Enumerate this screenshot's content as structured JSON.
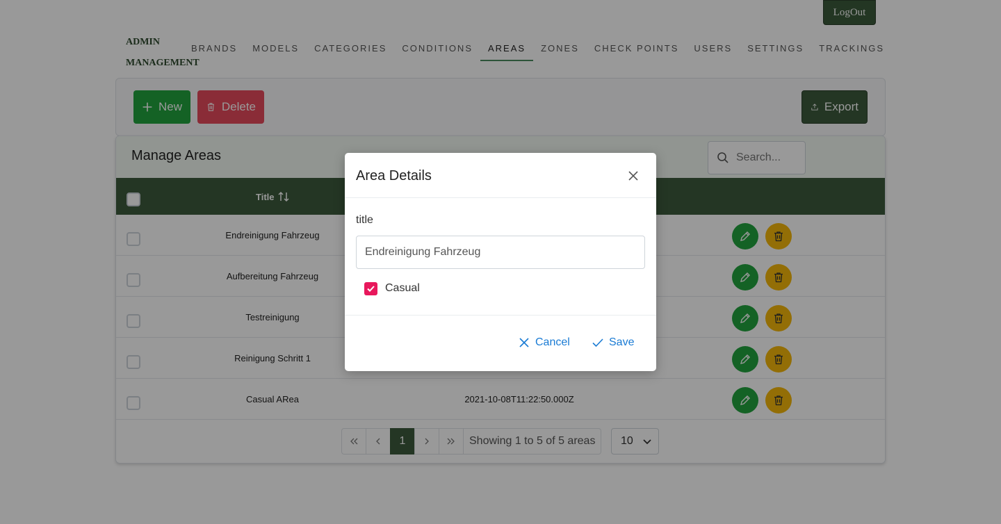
{
  "header": {
    "logout_label": "LogOut",
    "brand_line1": "ADMIN",
    "brand_line2": "MANAGEMENT",
    "nav": [
      {
        "label": "BRANDS",
        "active": false
      },
      {
        "label": "MODELS",
        "active": false
      },
      {
        "label": "CATEGORIES",
        "active": false
      },
      {
        "label": "CONDITIONS",
        "active": false
      },
      {
        "label": "AREAS",
        "active": true
      },
      {
        "label": "ZONES",
        "active": false
      },
      {
        "label": "CHECK POINTS",
        "active": false
      },
      {
        "label": "USERS",
        "active": false
      },
      {
        "label": "SETTINGS",
        "active": false
      },
      {
        "label": "TRACKINGS",
        "active": false
      }
    ]
  },
  "toolbar": {
    "new_label": "New",
    "delete_label": "Delete",
    "export_label": "Export"
  },
  "table": {
    "title": "Manage Areas",
    "search_placeholder": "Search...",
    "columns": {
      "title": "Title"
    },
    "rows": [
      {
        "title": "Endreinigung Fahrzeug",
        "date": ""
      },
      {
        "title": "Aufbereitung Fahrzeug",
        "date": ""
      },
      {
        "title": "Testreinigung",
        "date": ""
      },
      {
        "title": "Reinigung Schritt 1",
        "date": ""
      },
      {
        "title": "Casual ARea",
        "date": "2021-10-08T11:22:50.000Z"
      }
    ]
  },
  "pagination": {
    "current_page": "1",
    "info": "Showing 1 to 5 of 5 areas",
    "per_page": "10"
  },
  "modal": {
    "title": "Area Details",
    "field_label": "title",
    "field_value": "Endreinigung Fahrzeug",
    "checkbox_label": "Casual",
    "checkbox_checked": true,
    "cancel_label": "Cancel",
    "save_label": "Save"
  },
  "colors": {
    "primary_dark_green": "#3d5a3d",
    "success_green": "#22a33e",
    "danger_red": "#e74a5c",
    "warning_yellow": "#f5b70a",
    "checkbox_pink": "#e8185c",
    "link_blue": "#1a7bd4"
  }
}
